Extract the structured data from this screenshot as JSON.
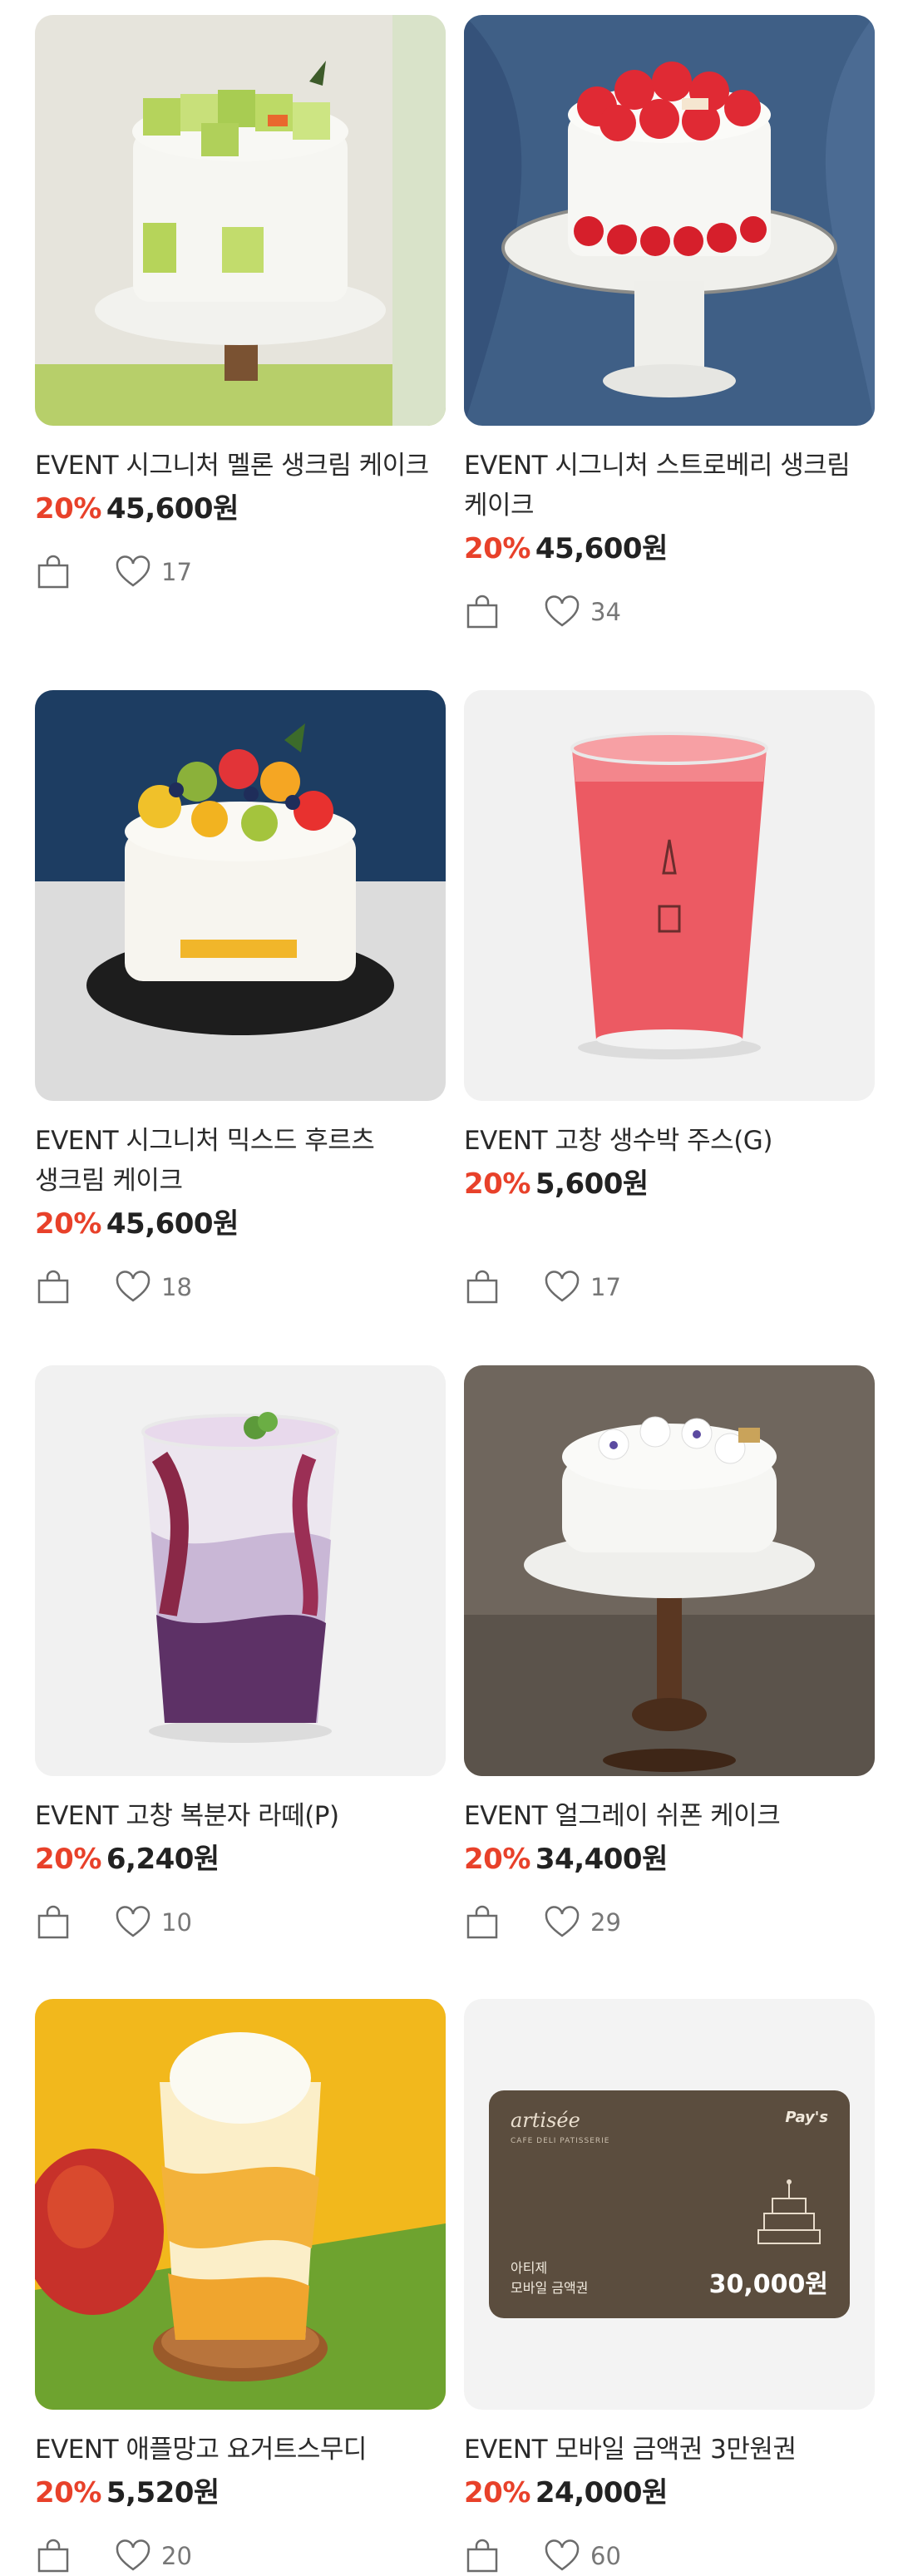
{
  "products": [
    {
      "title": "EVENT 시그니처 멜론 생크림 케이크",
      "discount": "20%",
      "price": "45,600원",
      "likes": "17"
    },
    {
      "title": "EVENT 시그니처 스트로베리 생크림 케이크",
      "discount": "20%",
      "price": "45,600원",
      "likes": "34"
    },
    {
      "title": "EVENT 시그니처 믹스드 후르츠 생크림 케이크",
      "discount": "20%",
      "price": "45,600원",
      "likes": "18"
    },
    {
      "title": "EVENT 고창 생수박 주스(G)",
      "discount": "20%",
      "price": "5,600원",
      "likes": "17"
    },
    {
      "title": "EVENT 고창 복분자 라떼(P)",
      "discount": "20%",
      "price": "6,240원",
      "likes": "10"
    },
    {
      "title": "EVENT 얼그레이 쉬폰 케이크",
      "discount": "20%",
      "price": "34,400원",
      "likes": "29"
    },
    {
      "title": "EVENT 애플망고 요거트스무디",
      "discount": "20%",
      "price": "5,520원",
      "likes": "20"
    },
    {
      "title": "EVENT 모바일 금액권 3만원권",
      "discount": "20%",
      "price": "24,000원",
      "likes": "60"
    }
  ],
  "gift_card": {
    "brand": "artisée",
    "sub": "CAFE DELI PATISSERIE",
    "pay": "Pay's",
    "label_line1": "아티제",
    "label_line2": "모바일 금액권",
    "amount": "30,000원"
  },
  "colors": {
    "discount": "#e8412a",
    "icon": "#6b6b6b"
  },
  "icons": {
    "cart": "shopping-bag-icon",
    "like": "heart-outline-icon"
  }
}
